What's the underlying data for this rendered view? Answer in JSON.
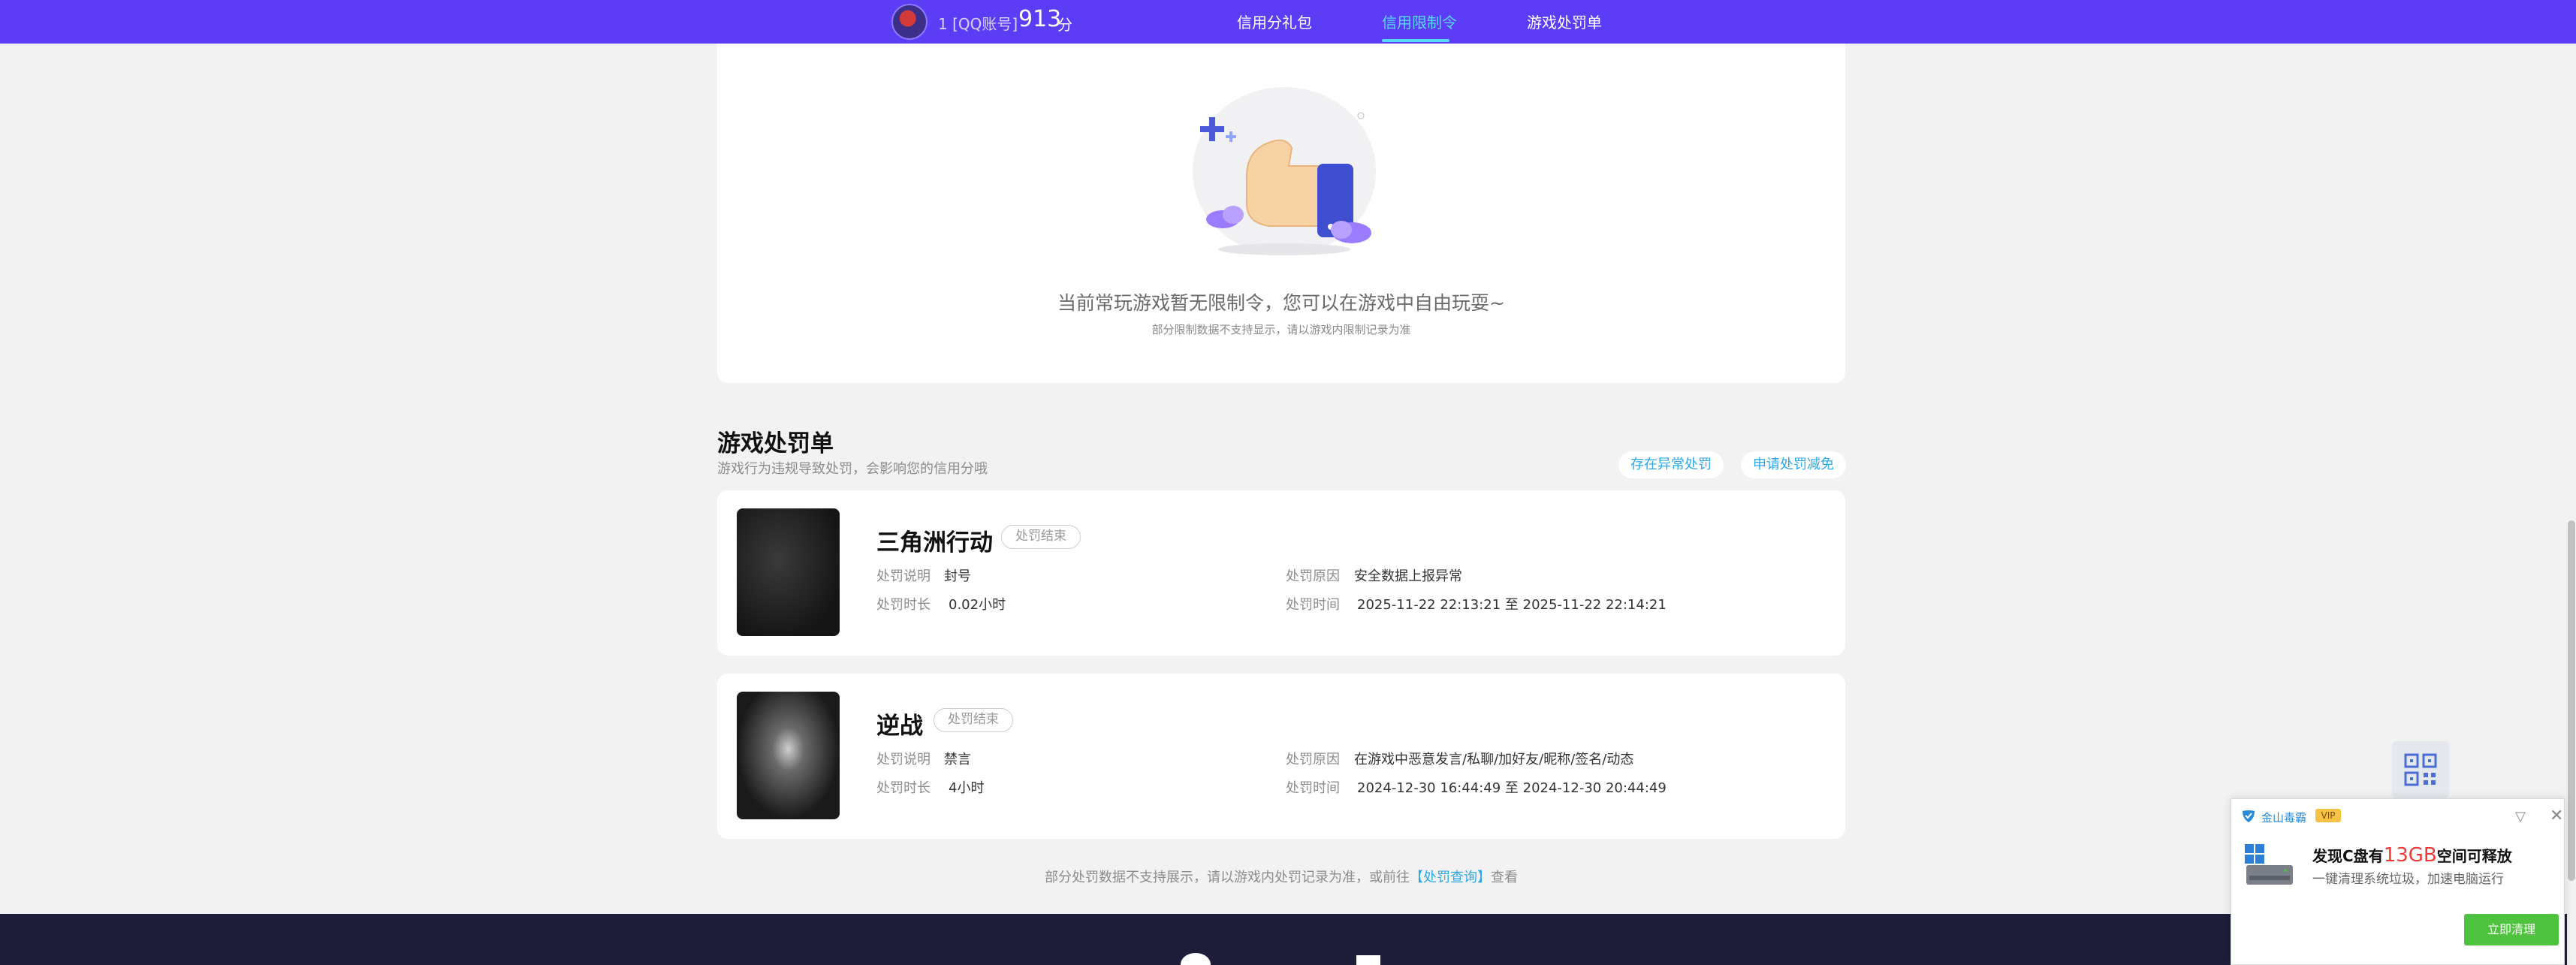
{
  "header": {
    "uid": "1 [QQ账号]",
    "score": "913",
    "score_unit": "分",
    "tabs": [
      {
        "label": "信用分礼包"
      },
      {
        "label": "信用限制令"
      },
      {
        "label": "游戏处罚单"
      }
    ],
    "active_tab": 1
  },
  "restriction_card": {
    "message": "当前常玩游戏暂无限制令，您可以在游戏中自由玩耍~",
    "note": "部分限制数据不支持显示，请以游戏内限制记录为准"
  },
  "penalty_section": {
    "title": "游戏处罚单",
    "subtitle": "游戏行为违规导致处罚，会影响您的信用分哦",
    "buttons": {
      "abnormal": "存在异常处罚",
      "reduce": "申请处罚减免"
    }
  },
  "penalties": [
    {
      "game": "三角洲行动",
      "status": "处罚结束",
      "desc_label": "处罚说明",
      "desc": "封号",
      "duration_label": "处罚时长",
      "duration": "0.02小时",
      "reason_label": "处罚原因",
      "reason": "安全数据上报异常",
      "time_label": "处罚时间",
      "time": "2025-11-22 22:13:21 至 2025-11-22 22:14:21"
    },
    {
      "game": "逆战",
      "status": "处罚结束",
      "desc_label": "处罚说明",
      "desc": "禁言",
      "duration_label": "处罚时长",
      "duration": "4小时",
      "reason_label": "处罚原因",
      "reason": "在游戏中恶意发言/私聊/加好友/昵称/签名/动态",
      "time_label": "处罚时间",
      "time": "2024-12-30 16:44:49 至 2024-12-30 20:44:49"
    }
  ],
  "footnote": {
    "prefix": "部分处罚数据不支持展示，请以游戏内处罚记录为准，或前往",
    "link": "【处罚查询】",
    "suffix": "查看"
  },
  "popup": {
    "brand": "金山毒霸",
    "vip": "VIP",
    "headline_prefix": "发现C盘有",
    "headline_amount": "13GB",
    "headline_suffix": "空间可释放",
    "sub": "一键清理系统垃圾，加速电脑运行",
    "button": "立即清理"
  },
  "colors": {
    "nav_bg": "#5c3cf5",
    "accent": "#58d8ff",
    "link": "#2ba8e8",
    "footer_bg": "#1e1d3a",
    "popup_button": "#4fc23f"
  },
  "icons": [
    "thumbs-up-illustration",
    "qr-code-icon",
    "chevron-down-icon",
    "close-icon",
    "disk-icon"
  ]
}
